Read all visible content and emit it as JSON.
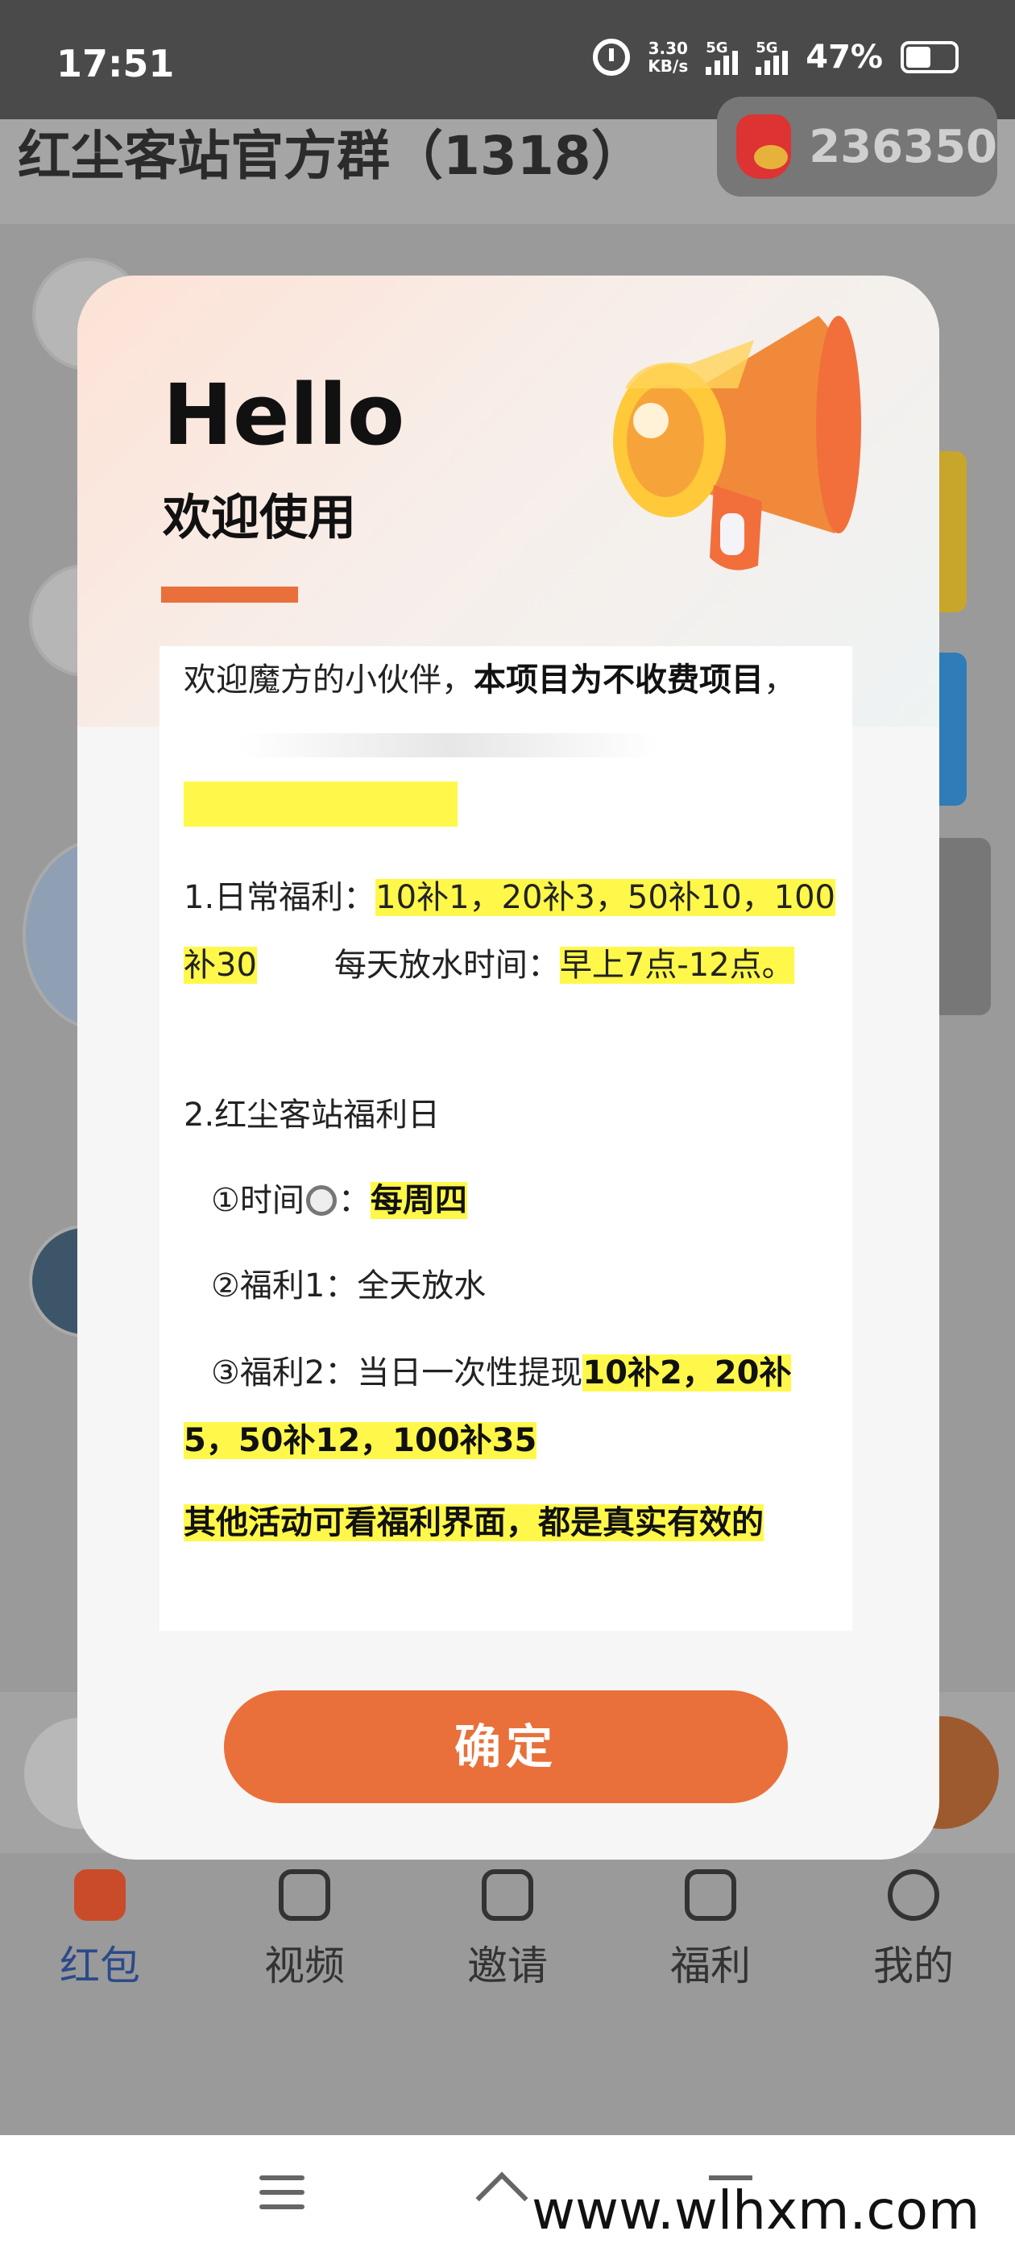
{
  "status_bar": {
    "time": "17:51",
    "net_speed_value": "3.30",
    "net_speed_unit": "KB/s",
    "signal_1": "5G",
    "signal_2": "5G",
    "battery": "47%",
    "battery_level": 0.47
  },
  "background": {
    "group_title": "红尘客站官方群（1318）",
    "coin_count": "236350",
    "tabs": [
      {
        "label": "红包",
        "icon": "red-envelope-icon",
        "active": true
      },
      {
        "label": "视频",
        "icon": "video-icon",
        "active": false
      },
      {
        "label": "邀请",
        "icon": "tv-icon",
        "active": false
      },
      {
        "label": "福利",
        "icon": "gift-icon",
        "active": false
      },
      {
        "label": "我的",
        "icon": "user-icon",
        "active": false
      }
    ]
  },
  "modal": {
    "hello": "Hello",
    "subtitle": "欢迎使用",
    "intro_plain": "欢迎魔方的小伙伴，",
    "intro_bold": "本项目为不收费项目",
    "intro_tail": "，",
    "item1_label": "1.日常福利：",
    "item1_value": "10补1，20补3，50补10，100补30",
    "item1_time_label": "每天放水时间：",
    "item1_time_value": "早上7点-12点。",
    "item2_title": "2.红尘客站福利日",
    "item2_time_label": "①时间",
    "item2_time_sep": "：",
    "item2_time_value": "每周四",
    "item2_benefit1": "②福利1：全天放水",
    "item2_benefit2_label": "③福利2：当日一次性提现",
    "item2_benefit2_value": "10补2，20补5，50补12，100补35",
    "closing": "其他活动可看福利界面，都是真实有效的",
    "confirm": "确定"
  },
  "watermark": "www.wlhxm.com",
  "colors": {
    "accent": "#e9703a",
    "highlight": "#fff84a"
  }
}
